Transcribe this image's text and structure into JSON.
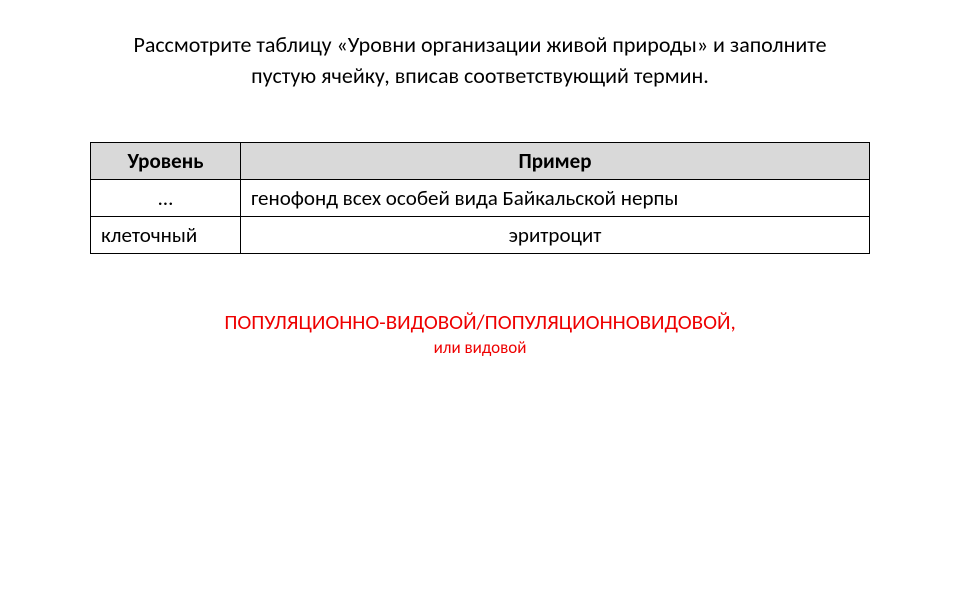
{
  "instruction": {
    "line1": "Рассмотрите таблицу «Уровни организации живой природы» и заполните",
    "line2": "пустую ячейку, вписав соответствующий термин."
  },
  "table": {
    "headers": {
      "col1": "Уровень",
      "col2": "Пример"
    },
    "rows": [
      {
        "level": "…",
        "example": "генофонд всех особей вида Байкальской нерпы"
      },
      {
        "level": "клеточный",
        "example": "эритроцит"
      }
    ]
  },
  "answer": {
    "main": "ПОПУЛЯЦИОННО-ВИДОВОЙ/ПОПУЛЯЦИОННОВИДОВОЙ,",
    "sub": "или видовой"
  }
}
